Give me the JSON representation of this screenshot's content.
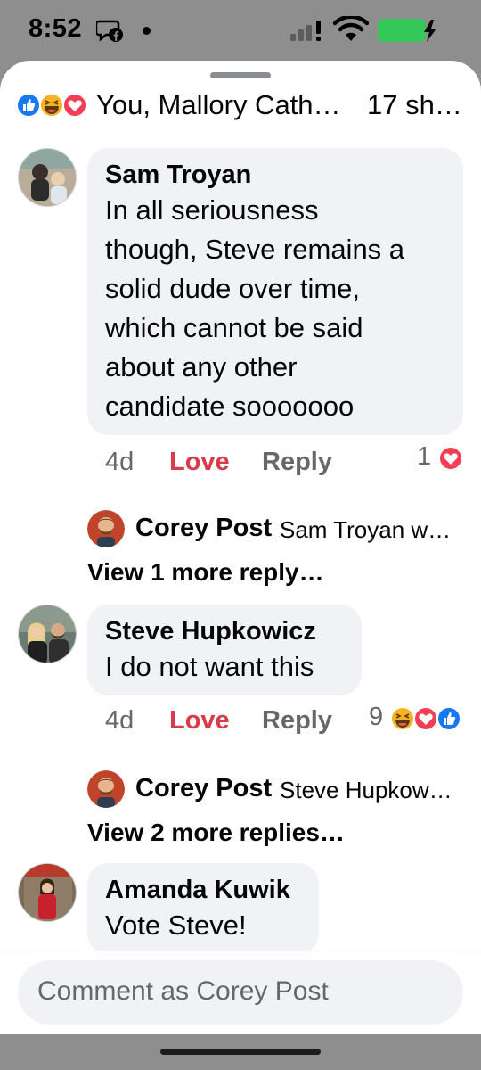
{
  "status_bar": {
    "time": "8:52",
    "icons": [
      "messenger-facebook-icon",
      "dot-icon",
      "cellular-signal-icon",
      "wifi-icon",
      "battery-charging-icon"
    ],
    "battery_color": "#34c759"
  },
  "post_summary": {
    "reaction_icons": [
      "like-icon",
      "haha-icon",
      "love-icon"
    ],
    "names": "You, Mallory Cath…",
    "shares": "17 sh…"
  },
  "comments": [
    {
      "author": "Sam Troyan",
      "lines": [
        "In all seriousness",
        "though, Steve remains a",
        "solid dude over time,",
        "which cannot be said",
        "about any other",
        "candidate sooooooo"
      ],
      "time": "4d",
      "love_label": "Love",
      "reply_label": "Reply",
      "reaction_count": "1",
      "reactions": [
        "love-icon"
      ],
      "reply_preview": {
        "author": "Corey Post",
        "snippet": "Sam Troyan w…"
      },
      "view_more": "View 1 more reply…"
    },
    {
      "author": "Steve Hupkowicz",
      "lines": [
        "I do not want this"
      ],
      "time": "4d",
      "love_label": "Love",
      "reply_label": "Reply",
      "reaction_count": "9",
      "reactions": [
        "haha-icon",
        "love-icon",
        "like-icon"
      ],
      "reply_preview": {
        "author": "Corey Post",
        "snippet": "Steve Hupkow…"
      },
      "view_more": "View 2 more replies…"
    },
    {
      "author": "Amanda Kuwik",
      "lines": [
        "Vote Steve!"
      ]
    }
  ],
  "composer": {
    "placeholder": "Comment as Corey Post"
  },
  "colors": {
    "like": "#1877f2",
    "love": "#f33e58",
    "haha": "#f7b125",
    "love_label": "#d93b4b",
    "bubble": "#f0f2f5"
  }
}
